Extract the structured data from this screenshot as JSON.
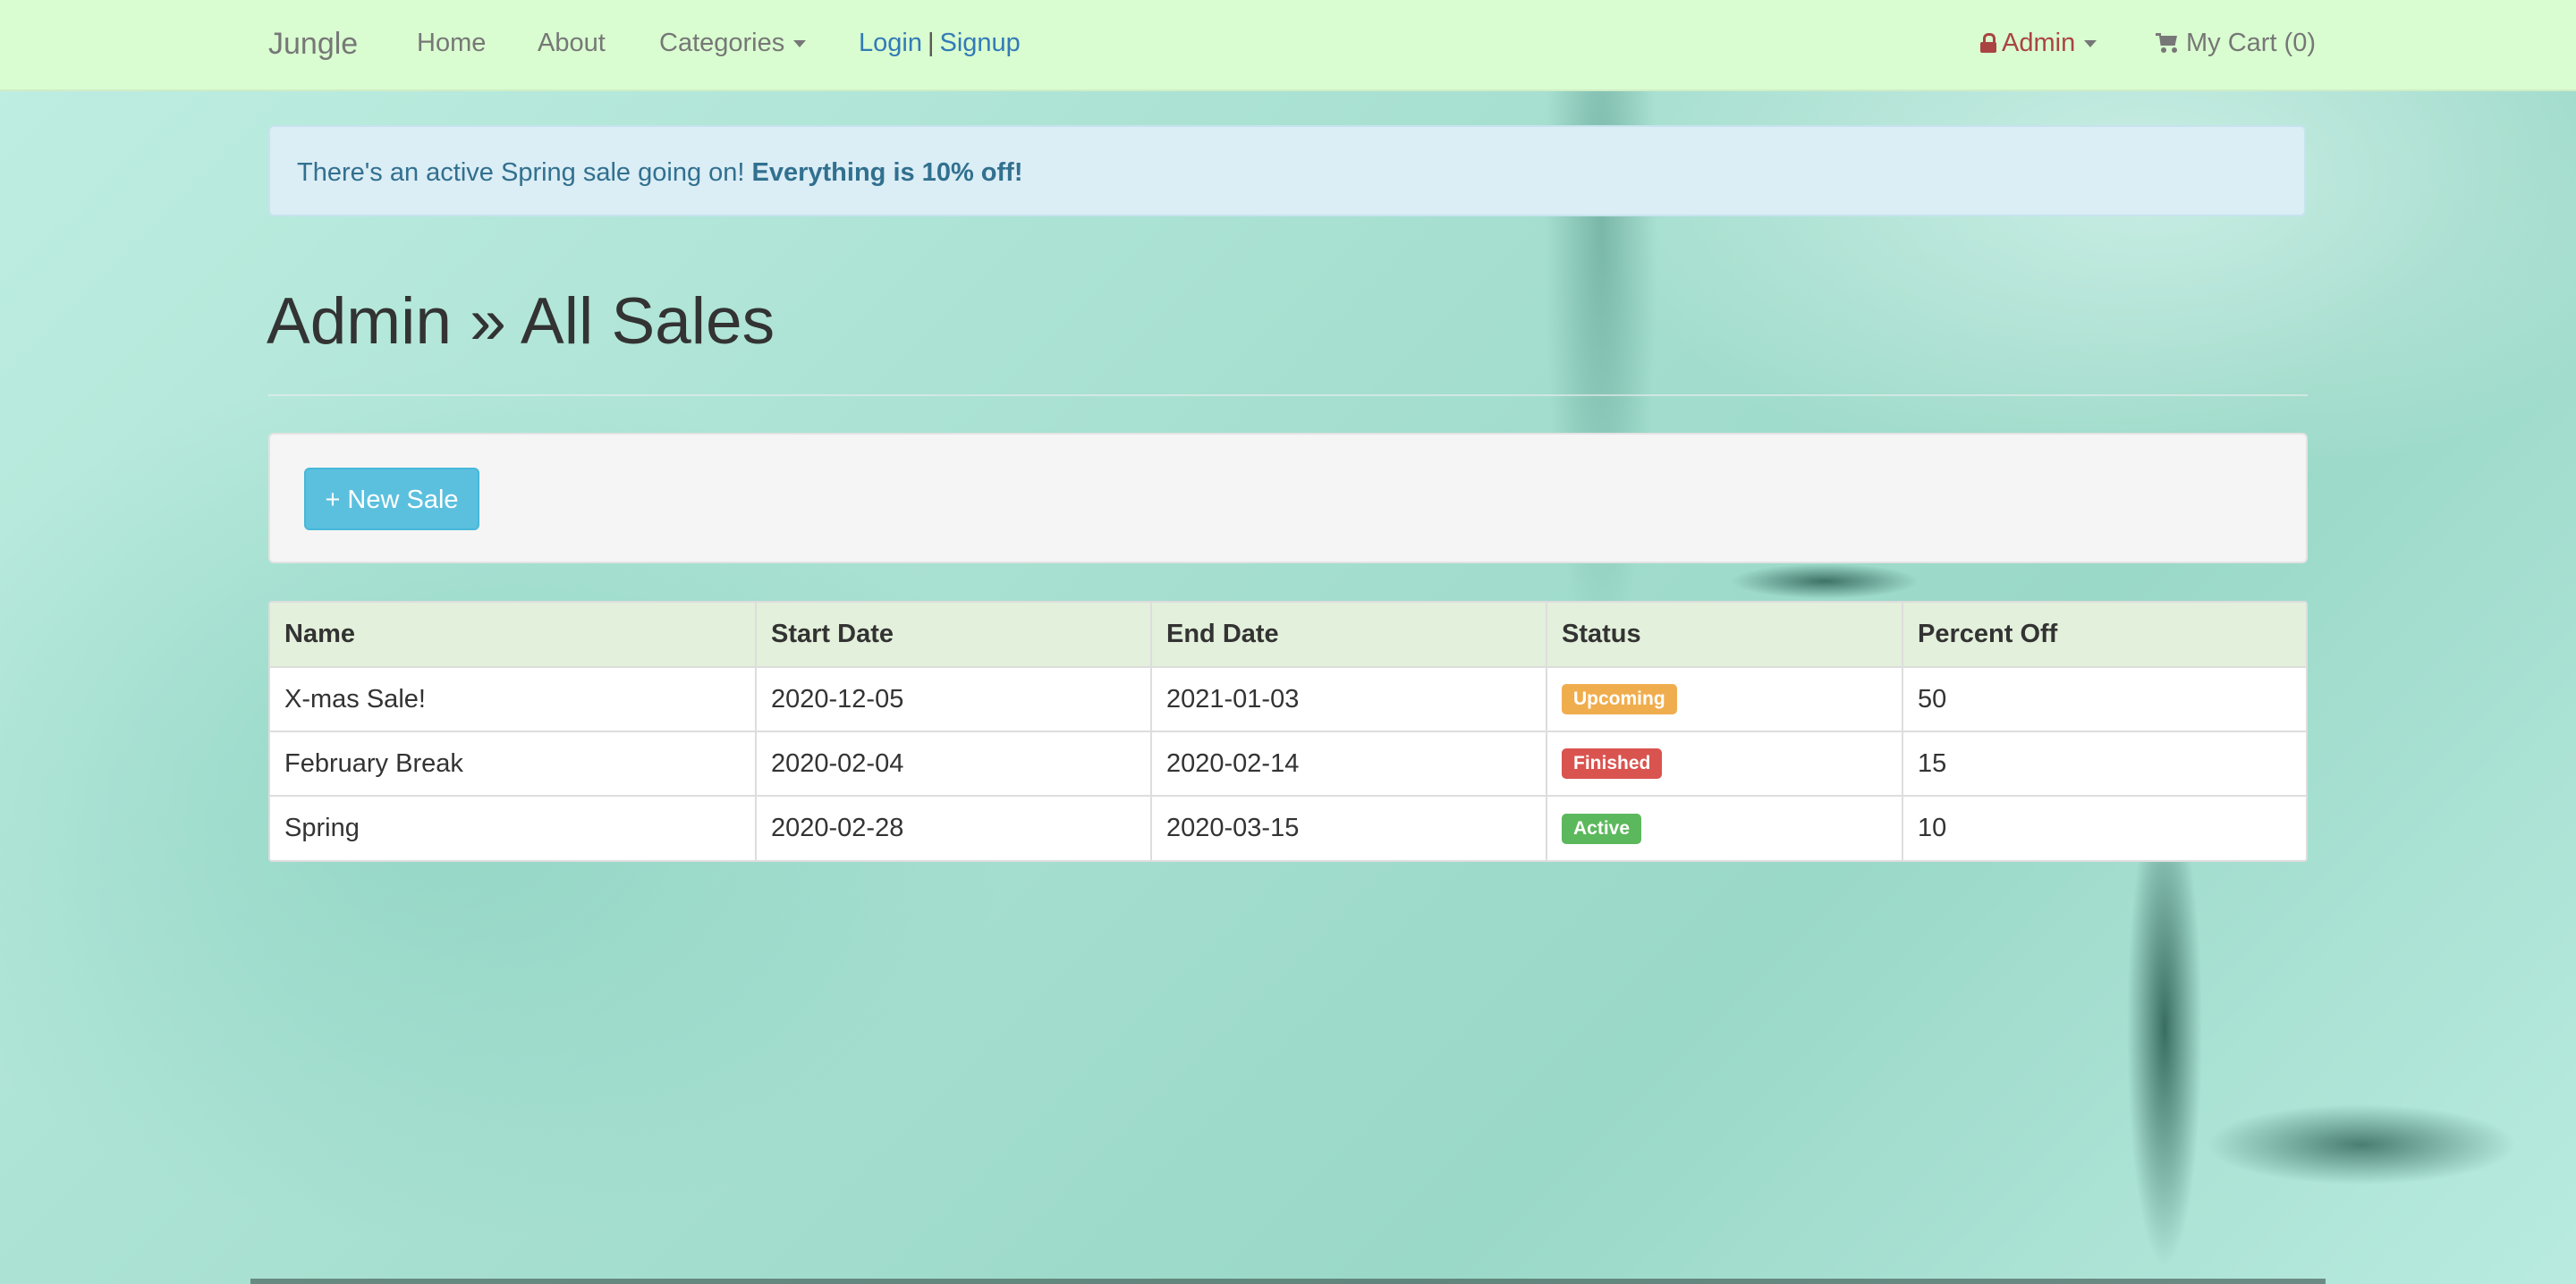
{
  "colors": {
    "navbar_bg": "#d9fdd0",
    "link": "#337ab7",
    "admin": "#a94442",
    "alert_bg": "#dbedf5",
    "info_button": "#5bc0de",
    "table_header_bg": "#e3f0db",
    "status_upcoming": "#f0ad4e",
    "status_finished": "#d9534f",
    "status_active": "#5cb85c"
  },
  "navbar": {
    "brand": "Jungle",
    "links": {
      "home": "Home",
      "about": "About",
      "categories": "Categories"
    },
    "login": "Login",
    "separator": "|",
    "signup": "Signup",
    "admin": "Admin",
    "cart": "My Cart (0)",
    "icons": {
      "admin": "lock-icon",
      "cart": "shopping-cart-icon",
      "dropdown": "caret-down-icon"
    }
  },
  "alert": {
    "text": "There's an active Spring sale going on! ",
    "emphasis": "Everything is 10% off!"
  },
  "page": {
    "title": "Admin » All Sales",
    "new_sale_button": "+ New Sale"
  },
  "table": {
    "headers": [
      "Name",
      "Start Date",
      "End Date",
      "Status",
      "Percent Off"
    ],
    "rows": [
      {
        "name": "X-mas Sale!",
        "start": "2020-12-05",
        "end": "2021-01-03",
        "status": "Upcoming",
        "status_color": "#f0ad4e",
        "percent": "50"
      },
      {
        "name": "February Break",
        "start": "2020-02-04",
        "end": "2020-02-14",
        "status": "Finished",
        "status_color": "#d9534f",
        "percent": "15"
      },
      {
        "name": "Spring",
        "start": "2020-02-28",
        "end": "2020-03-15",
        "status": "Active",
        "status_color": "#5cb85c",
        "percent": "10"
      }
    ]
  }
}
